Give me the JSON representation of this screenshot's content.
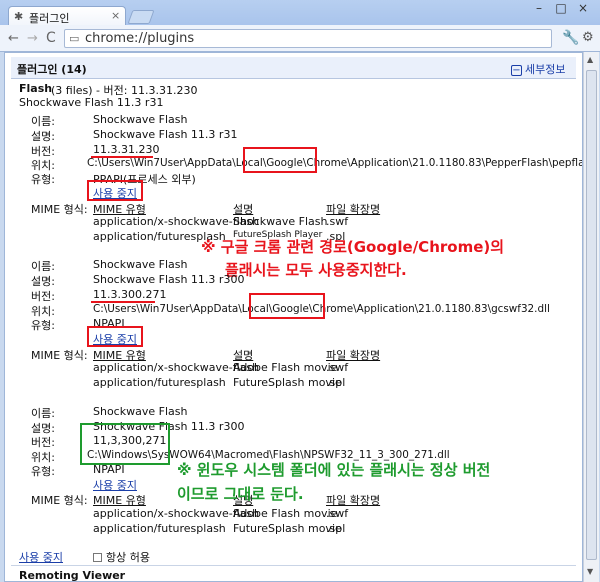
{
  "window": {
    "tab_icon": "puzzle-icon",
    "tab_title": "플러그인",
    "tab_close": "×",
    "buttons": [
      "–",
      "□",
      "×"
    ]
  },
  "toolbar": {
    "back": "←",
    "forward": "→",
    "reload": "C",
    "url": "chrome://plugins",
    "menu1": "🔧",
    "menu2": "⚙"
  },
  "header": {
    "title": "플러그인 (14)",
    "details_icon": "−",
    "details_label": "세부정보"
  },
  "flash": {
    "name": "Flash",
    "summary": "(3 files) - 버전: 11.3.31.230",
    "subtitle": "Shockwave Flash 11.3 r31",
    "labels": {
      "name": "이름:",
      "desc": "설명:",
      "version": "버전:",
      "location": "위치:",
      "type": "유형:",
      "mime": "MIME 형식:"
    },
    "mime_headers": [
      "MIME 유형",
      "설명",
      "파일 확장명"
    ],
    "files": [
      {
        "name": "Shockwave Flash",
        "desc": "Shockwave Flash 11.3 r31",
        "version": "11.3.31.230",
        "location": "C:\\Users\\Win7User\\AppData\\Local\\Google\\Chrome\\Application\\21.0.1180.83\\PepperFlash\\pepflashplayer.dll",
        "type": "PPAPI(프로세스 외부)",
        "disable": "사용 중지",
        "mime": [
          [
            "application/x-shockwave-flash",
            "Shockwave Flash",
            ".swf"
          ],
          [
            "application/futuresplash",
            "FutureSplash Player",
            ".spl"
          ]
        ]
      },
      {
        "name": "Shockwave Flash",
        "desc": "Shockwave Flash 11.3 r300",
        "version": "11.3.300.271",
        "location": "C:\\Users\\Win7User\\AppData\\Local\\Google\\Chrome\\Application\\21.0.1180.83\\gcswf32.dll",
        "type": "NPAPI",
        "disable": "사용 중지",
        "mime": [
          [
            "application/x-shockwave-flash",
            "Adobe Flash movie",
            ".swf"
          ],
          [
            "application/futuresplash",
            "FutureSplash movie",
            ".spl"
          ]
        ]
      },
      {
        "name": "Shockwave Flash",
        "desc": "Shockwave Flash 11.3 r300",
        "version": "11,3,300,271",
        "location": "C:\\Windows\\SysWOW64\\Macromed\\Flash\\NPSWF32_11_3_300_271.dll",
        "type": "NPAPI",
        "disable": "사용 중지",
        "mime": [
          [
            "application/x-shockwave-flash",
            "Adobe Flash movie",
            ".swf"
          ],
          [
            "application/futuresplash",
            "FutureSplash movie",
            ".spl"
          ]
        ]
      }
    ],
    "footer_disable": "사용 중지",
    "always_allow": "항상 허용"
  },
  "next_plugin": "Remoting Viewer",
  "annotations": {
    "red_line1": "※ 구글 크롬 관련 경로(Google/Chrome)의",
    "red_line2": "플래시는 모두 사용중지한다.",
    "green_line1": "※ 윈도우 시스템 폴더에 있는 플래시는 정상 버전",
    "green_line2": "이므로 그대로 둔다."
  },
  "colors": {
    "red": "#e8141c",
    "green": "#1e9b2e",
    "link": "#1a3ea8"
  }
}
